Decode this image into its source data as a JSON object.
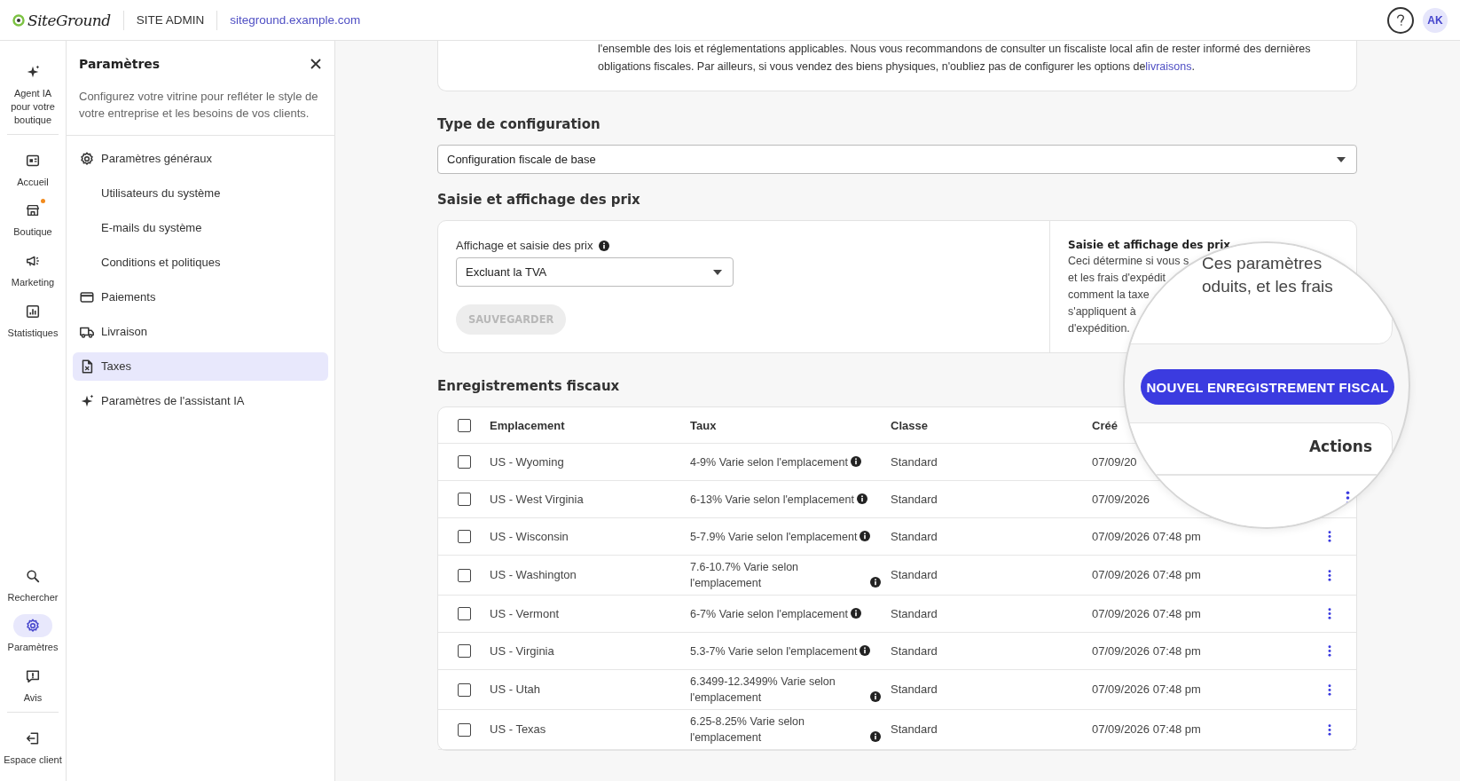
{
  "topbar": {
    "logo": "SiteGround",
    "section": "SITE ADMIN",
    "domain": "siteground.example.com",
    "avatar": "AK"
  },
  "rail": {
    "upper": [
      {
        "items": [
          {
            "label": "Agent IA pour votre boutique",
            "selected": false,
            "badge": false
          }
        ]
      },
      {
        "items": [
          {
            "label": "Accueil",
            "selected": false,
            "badge": false
          },
          {
            "label": "Boutique",
            "selected": false,
            "badge": true
          },
          {
            "label": "Marketing",
            "selected": false,
            "badge": false
          },
          {
            "label": "Statistiques",
            "selected": false,
            "badge": false
          }
        ]
      }
    ],
    "lower": [
      {
        "items": [
          {
            "label": "Rechercher",
            "selected": false,
            "badge": false
          },
          {
            "label": "Paramètres",
            "selected": true,
            "badge": false
          },
          {
            "label": "Avis",
            "selected": false,
            "badge": false
          }
        ]
      },
      {
        "items": [
          {
            "label": "Espace client",
            "selected": false,
            "badge": false
          }
        ]
      }
    ]
  },
  "settings": {
    "title": "Paramètres",
    "description": "Configurez votre vitrine pour refléter le style de votre entreprise et les besoins de vos clients.",
    "items": [
      {
        "label": "Paramètres généraux",
        "selected": false
      },
      {
        "label": "Utilisateurs du système",
        "selected": false
      },
      {
        "label": "E-mails du système",
        "selected": false
      },
      {
        "label": "Conditions et politiques",
        "selected": false
      },
      {
        "label": "Paiements",
        "selected": false
      },
      {
        "label": "Livraison",
        "selected": false
      },
      {
        "label": "Taxes",
        "selected": true
      },
      {
        "label": "Paramètres de l'assistant IA",
        "selected": false
      }
    ]
  },
  "notice": {
    "text": "l'ensemble des lois et réglementations applicables. Nous vous recommandons de consulter un fiscaliste local afin de rester informé des dernières obligations fiscales. Par ailleurs, si vous vendez des biens physiques, n'oubliez pas de configurer les options de",
    "link": "livraisons",
    "after": "."
  },
  "config_type": {
    "heading": "Type de configuration",
    "value": "Configuration fiscale de base"
  },
  "prices": {
    "heading": "Saisie et affichage des prix",
    "field_label": "Affichage et saisie des prix",
    "value": "Excluant la TVA",
    "save": "SAUVEGARDER",
    "save_disabled": true,
    "help_title": "Saisie et affichage des prix",
    "help_lines": [
      "Ceci détermine si vous s",
      "et les frais d'expédit",
      "comment la taxe",
      "s'appliquent à",
      "d'expédition."
    ]
  },
  "records": {
    "heading": "Enregistrements fiscaux",
    "all_checked": false,
    "columns": [
      "Emplacement",
      "Taux",
      "Classe",
      "Créé"
    ],
    "rows": [
      {
        "checked": false,
        "location": "US - Wyoming",
        "rate": "4-9% Varie selon l'emplacement",
        "class": "Standard",
        "created": "07/09/20"
      },
      {
        "checked": false,
        "location": "US - West Virginia",
        "rate": "6-13% Varie selon l'emplacement",
        "class": "Standard",
        "created": "07/09/2026"
      },
      {
        "checked": false,
        "location": "US - Wisconsin",
        "rate": "5-7.9% Varie selon l'emplacement",
        "class": "Standard",
        "created": "07/09/2026 07:48 pm"
      },
      {
        "checked": false,
        "location": "US - Washington",
        "rate": "7.6-10.7% Varie selon l'emplacement",
        "class": "Standard",
        "created": "07/09/2026 07:48 pm"
      },
      {
        "checked": false,
        "location": "US - Vermont",
        "rate": "6-7% Varie selon l'emplacement",
        "class": "Standard",
        "created": "07/09/2026 07:48 pm"
      },
      {
        "checked": false,
        "location": "US - Virginia",
        "rate": "5.3-7% Varie selon l'emplacement",
        "class": "Standard",
        "created": "07/09/2026 07:48 pm"
      },
      {
        "checked": false,
        "location": "US - Utah",
        "rate": "6.3499-12.3499% Varie selon l'emplacement",
        "class": "Standard",
        "created": "07/09/2026 07:48 pm"
      },
      {
        "checked": false,
        "location": "US - Texas",
        "rate": "6.25-8.25% Varie selon l'emplacement",
        "class": "Standard",
        "created": "07/09/2026 07:48 pm"
      }
    ]
  },
  "lens": {
    "lines": [
      "Ces paramètres",
      "oduits, et les frais"
    ],
    "button": "NOUVEL ENREGISTREMENT FISCAL",
    "column": "Actions"
  }
}
